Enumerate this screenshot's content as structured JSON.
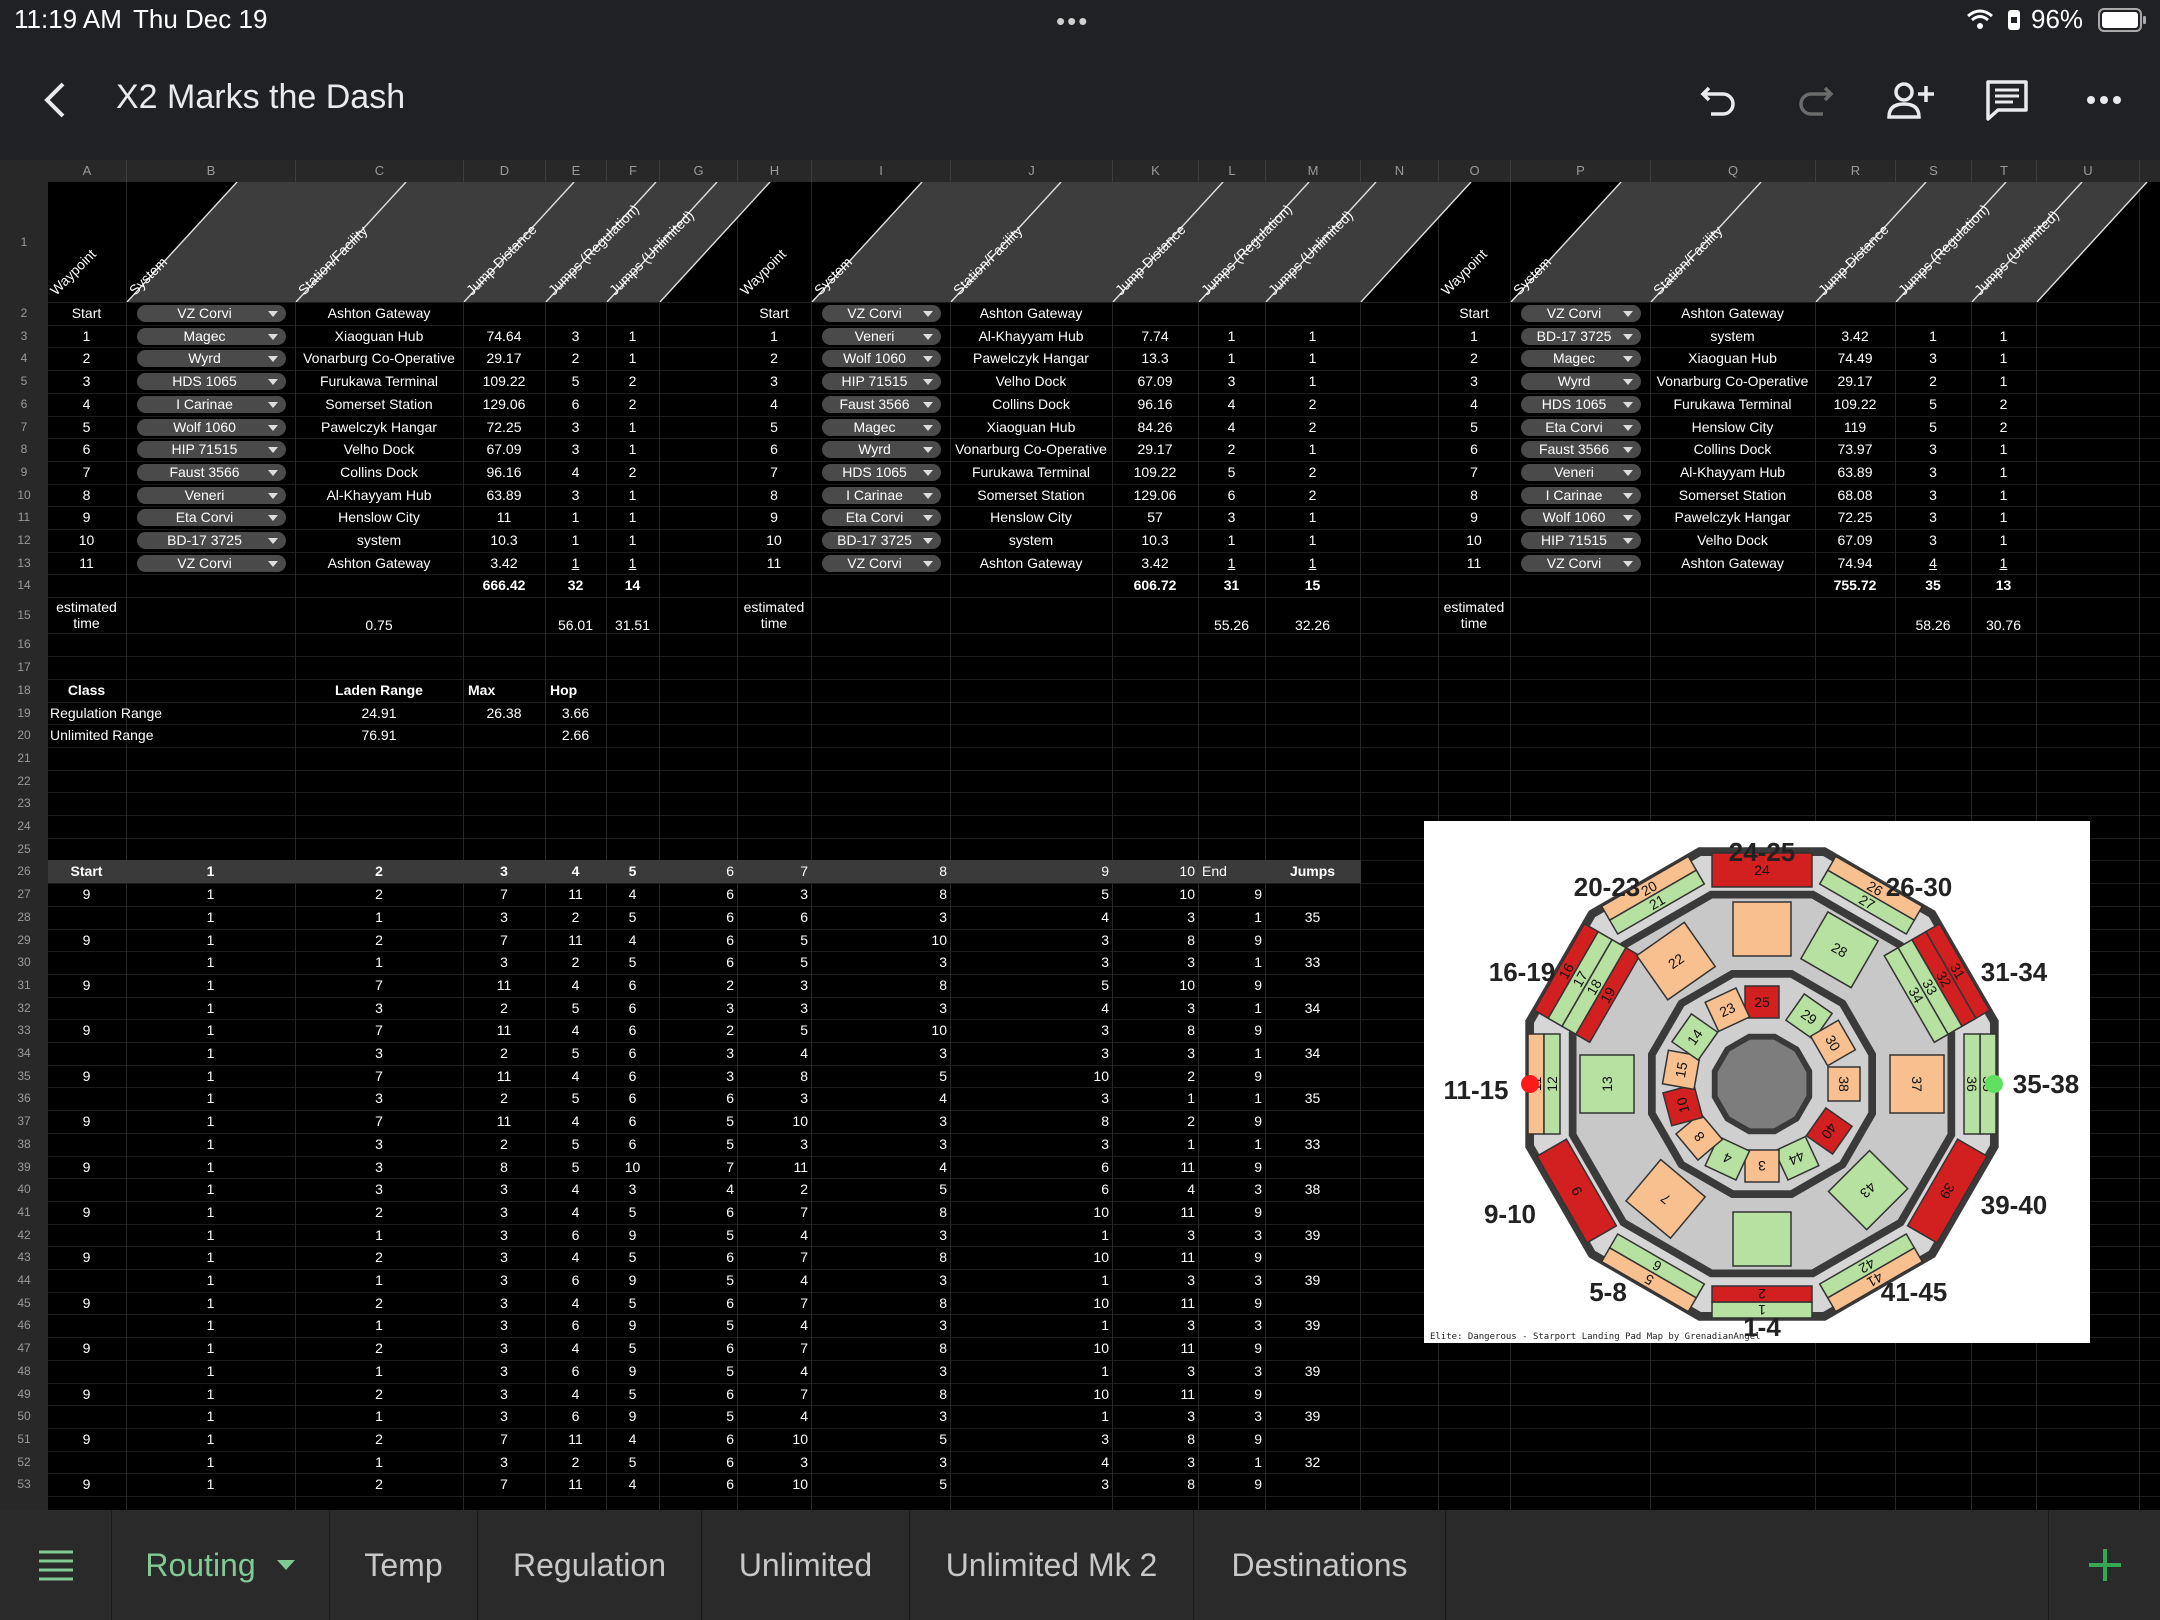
{
  "status": {
    "time": "11:19 AM",
    "date": "Thu Dec 19",
    "battery": "96%"
  },
  "title": "X2 Marks the Dash",
  "columns": [
    "A",
    "B",
    "C",
    "D",
    "E",
    "F",
    "G",
    "H",
    "I",
    "J",
    "K",
    "L",
    "M",
    "N",
    "O",
    "P",
    "Q",
    "R",
    "S",
    "T",
    "U"
  ],
  "header_labels": [
    "Waypoint",
    "System",
    "Station/Facility",
    "Jump Distance",
    "Jumps (Regulation)",
    "Jumps (Unlimited)"
  ],
  "routes": [
    {
      "rows": [
        [
          "Start",
          "VZ Corvi",
          "Ashton Gateway",
          "",
          "",
          ""
        ],
        [
          "1",
          "Magec",
          "Xiaoguan Hub",
          "74.64",
          "3",
          "1"
        ],
        [
          "2",
          "Wyrd",
          "Vonarburg Co-Operative",
          "29.17",
          "2",
          "1"
        ],
        [
          "3",
          "HDS 1065",
          "Furukawa Terminal",
          "109.22",
          "5",
          "2"
        ],
        [
          "4",
          "I Carinae",
          "Somerset Station",
          "129.06",
          "6",
          "2"
        ],
        [
          "5",
          "Wolf 1060",
          "Pawelczyk Hangar",
          "72.25",
          "3",
          "1"
        ],
        [
          "6",
          "HIP 71515",
          "Velho Dock",
          "67.09",
          "3",
          "1"
        ],
        [
          "7",
          "Faust 3566",
          "Collins Dock",
          "96.16",
          "4",
          "2"
        ],
        [
          "8",
          "Veneri",
          "Al-Khayyam Hub",
          "63.89",
          "3",
          "1"
        ],
        [
          "9",
          "Eta Corvi",
          "Henslow City",
          "11",
          "1",
          "1"
        ],
        [
          "10",
          "BD-17 3725",
          "system",
          "10.3",
          "1",
          "1"
        ],
        [
          "11",
          "VZ Corvi",
          "Ashton Gateway",
          "3.42",
          "1",
          "1"
        ]
      ],
      "total": [
        "666.42",
        "32",
        "14"
      ],
      "est_label": "estimated time",
      "est": [
        "0.75",
        "",
        "56.01",
        "31.51"
      ]
    },
    {
      "rows": [
        [
          "Start",
          "VZ Corvi",
          "Ashton Gateway",
          "",
          "",
          ""
        ],
        [
          "1",
          "Veneri",
          "Al-Khayyam Hub",
          "7.74",
          "1",
          "1"
        ],
        [
          "2",
          "Wolf 1060",
          "Pawelczyk Hangar",
          "13.3",
          "1",
          "1"
        ],
        [
          "3",
          "HIP 71515",
          "Velho Dock",
          "67.09",
          "3",
          "1"
        ],
        [
          "4",
          "Faust 3566",
          "Collins Dock",
          "96.16",
          "4",
          "2"
        ],
        [
          "5",
          "Magec",
          "Xiaoguan Hub",
          "84.26",
          "4",
          "2"
        ],
        [
          "6",
          "Wyrd",
          "Vonarburg Co-Operative",
          "29.17",
          "2",
          "1"
        ],
        [
          "7",
          "HDS 1065",
          "Furukawa Terminal",
          "109.22",
          "5",
          "2"
        ],
        [
          "8",
          "I Carinae",
          "Somerset Station",
          "129.06",
          "6",
          "2"
        ],
        [
          "9",
          "Eta Corvi",
          "Henslow City",
          "57",
          "3",
          "1"
        ],
        [
          "10",
          "BD-17 3725",
          "system",
          "10.3",
          "1",
          "1"
        ],
        [
          "11",
          "VZ Corvi",
          "Ashton Gateway",
          "3.42",
          "1",
          "1"
        ]
      ],
      "total": [
        "606.72",
        "31",
        "15"
      ],
      "est_label": "estimated time",
      "est": [
        "",
        "",
        "55.26",
        "32.26"
      ]
    },
    {
      "rows": [
        [
          "Start",
          "VZ Corvi",
          "Ashton Gateway",
          "",
          "",
          ""
        ],
        [
          "1",
          "BD-17 3725",
          "system",
          "3.42",
          "1",
          "1"
        ],
        [
          "2",
          "Magec",
          "Xiaoguan Hub",
          "74.49",
          "3",
          "1"
        ],
        [
          "3",
          "Wyrd",
          "Vonarburg Co-Operative",
          "29.17",
          "2",
          "1"
        ],
        [
          "4",
          "HDS 1065",
          "Furukawa Terminal",
          "109.22",
          "5",
          "2"
        ],
        [
          "5",
          "Eta Corvi",
          "Henslow City",
          "119",
          "5",
          "2"
        ],
        [
          "6",
          "Faust 3566",
          "Collins Dock",
          "73.97",
          "3",
          "1"
        ],
        [
          "7",
          "Veneri",
          "Al-Khayyam Hub",
          "63.89",
          "3",
          "1"
        ],
        [
          "8",
          "I Carinae",
          "Somerset Station",
          "68.08",
          "3",
          "1"
        ],
        [
          "9",
          "Wolf 1060",
          "Pawelczyk Hangar",
          "72.25",
          "3",
          "1"
        ],
        [
          "10",
          "HIP 71515",
          "Velho Dock",
          "67.09",
          "3",
          "1"
        ],
        [
          "11",
          "VZ Corvi",
          "Ashton Gateway",
          "74.94",
          "4",
          "1"
        ]
      ],
      "total": [
        "755.72",
        "35",
        "13"
      ],
      "est_label": "estimated time",
      "est": [
        "",
        "",
        "58.26",
        "30.76"
      ]
    }
  ],
  "ranges": {
    "headers": [
      "Class",
      "Laden Range",
      "Max",
      "Hop"
    ],
    "rows": [
      [
        "Regulation Range",
        "24.91",
        "26.38",
        "3.66"
      ],
      [
        "Unlimited Range",
        "76.91",
        "",
        "2.66"
      ]
    ]
  },
  "perm_header": [
    "Start",
    "1",
    "2",
    "3",
    "4",
    "5",
    "6",
    "7",
    "8",
    "9",
    "10",
    "End",
    "Jumps"
  ],
  "perm_rows": [
    [
      "9",
      "1",
      "2",
      "7",
      "11",
      "4",
      "6",
      "3",
      "8",
      "5",
      "10",
      "9",
      ""
    ],
    [
      "",
      "1",
      "1",
      "3",
      "2",
      "5",
      "6",
      "6",
      "3",
      "4",
      "3",
      "1",
      "35"
    ],
    [
      "9",
      "1",
      "2",
      "7",
      "11",
      "4",
      "6",
      "5",
      "10",
      "3",
      "8",
      "9",
      ""
    ],
    [
      "",
      "1",
      "1",
      "3",
      "2",
      "5",
      "6",
      "5",
      "3",
      "3",
      "3",
      "1",
      "33"
    ],
    [
      "9",
      "1",
      "7",
      "11",
      "4",
      "6",
      "2",
      "3",
      "8",
      "5",
      "10",
      "9",
      ""
    ],
    [
      "",
      "1",
      "3",
      "2",
      "5",
      "6",
      "3",
      "3",
      "3",
      "4",
      "3",
      "1",
      "34"
    ],
    [
      "9",
      "1",
      "7",
      "11",
      "4",
      "6",
      "2",
      "5",
      "10",
      "3",
      "8",
      "9",
      ""
    ],
    [
      "",
      "1",
      "3",
      "2",
      "5",
      "6",
      "3",
      "4",
      "3",
      "3",
      "3",
      "1",
      "34"
    ],
    [
      "9",
      "1",
      "7",
      "11",
      "4",
      "6",
      "3",
      "8",
      "5",
      "10",
      "2",
      "9",
      ""
    ],
    [
      "",
      "1",
      "3",
      "2",
      "5",
      "6",
      "6",
      "3",
      "4",
      "3",
      "1",
      "1",
      "35"
    ],
    [
      "9",
      "1",
      "7",
      "11",
      "4",
      "6",
      "5",
      "10",
      "3",
      "8",
      "2",
      "9",
      ""
    ],
    [
      "",
      "1",
      "3",
      "2",
      "5",
      "6",
      "5",
      "3",
      "3",
      "3",
      "1",
      "1",
      "33"
    ],
    [
      "9",
      "1",
      "3",
      "8",
      "5",
      "10",
      "7",
      "11",
      "4",
      "6",
      "11",
      "9",
      ""
    ],
    [
      "",
      "1",
      "3",
      "3",
      "4",
      "3",
      "4",
      "2",
      "5",
      "6",
      "4",
      "3",
      "38"
    ],
    [
      "9",
      "1",
      "2",
      "3",
      "4",
      "5",
      "6",
      "7",
      "8",
      "10",
      "11",
      "9",
      ""
    ],
    [
      "",
      "1",
      "1",
      "3",
      "6",
      "9",
      "5",
      "4",
      "3",
      "1",
      "3",
      "3",
      "39"
    ],
    [
      "9",
      "1",
      "2",
      "3",
      "4",
      "5",
      "6",
      "7",
      "8",
      "10",
      "11",
      "9",
      ""
    ],
    [
      "",
      "1",
      "1",
      "3",
      "6",
      "9",
      "5",
      "4",
      "3",
      "1",
      "3",
      "3",
      "39"
    ],
    [
      "9",
      "1",
      "2",
      "3",
      "4",
      "5",
      "6",
      "7",
      "8",
      "10",
      "11",
      "9",
      ""
    ],
    [
      "",
      "1",
      "1",
      "3",
      "6",
      "9",
      "5",
      "4",
      "3",
      "1",
      "3",
      "3",
      "39"
    ],
    [
      "9",
      "1",
      "2",
      "3",
      "4",
      "5",
      "6",
      "7",
      "8",
      "10",
      "11",
      "9",
      ""
    ],
    [
      "",
      "1",
      "1",
      "3",
      "6",
      "9",
      "5",
      "4",
      "3",
      "1",
      "3",
      "3",
      "39"
    ],
    [
      "9",
      "1",
      "2",
      "3",
      "4",
      "5",
      "6",
      "7",
      "8",
      "10",
      "11",
      "9",
      ""
    ],
    [
      "",
      "1",
      "1",
      "3",
      "6",
      "9",
      "5",
      "4",
      "3",
      "1",
      "3",
      "3",
      "39"
    ],
    [
      "9",
      "1",
      "2",
      "7",
      "11",
      "4",
      "6",
      "10",
      "5",
      "3",
      "8",
      "9",
      ""
    ],
    [
      "",
      "1",
      "1",
      "3",
      "2",
      "5",
      "6",
      "3",
      "3",
      "4",
      "3",
      "1",
      "32"
    ],
    [
      "9",
      "1",
      "2",
      "7",
      "11",
      "4",
      "6",
      "10",
      "5",
      "3",
      "8",
      "9",
      ""
    ]
  ],
  "padmap": {
    "caption": "Elite: Dangerous - Starport Landing Pad Map by GrenadianAngel",
    "groups": [
      "24-25",
      "26-30",
      "31-34",
      "35-38",
      "39-40",
      "41-45",
      "1-4",
      "5-8",
      "9-10",
      "11-15",
      "16-19",
      "20-23"
    ]
  },
  "sheet_tabs": [
    "Routing",
    "Temp",
    "Regulation",
    "Unlimited",
    "Unlimited Mk 2",
    "Destinations"
  ],
  "colors": {
    "tab_active": "#81c995",
    "pad_green": "#b7e1a1",
    "pad_orange": "#f8c08f",
    "pad_red": "#d21f1f",
    "add_button": "#34a853"
  }
}
